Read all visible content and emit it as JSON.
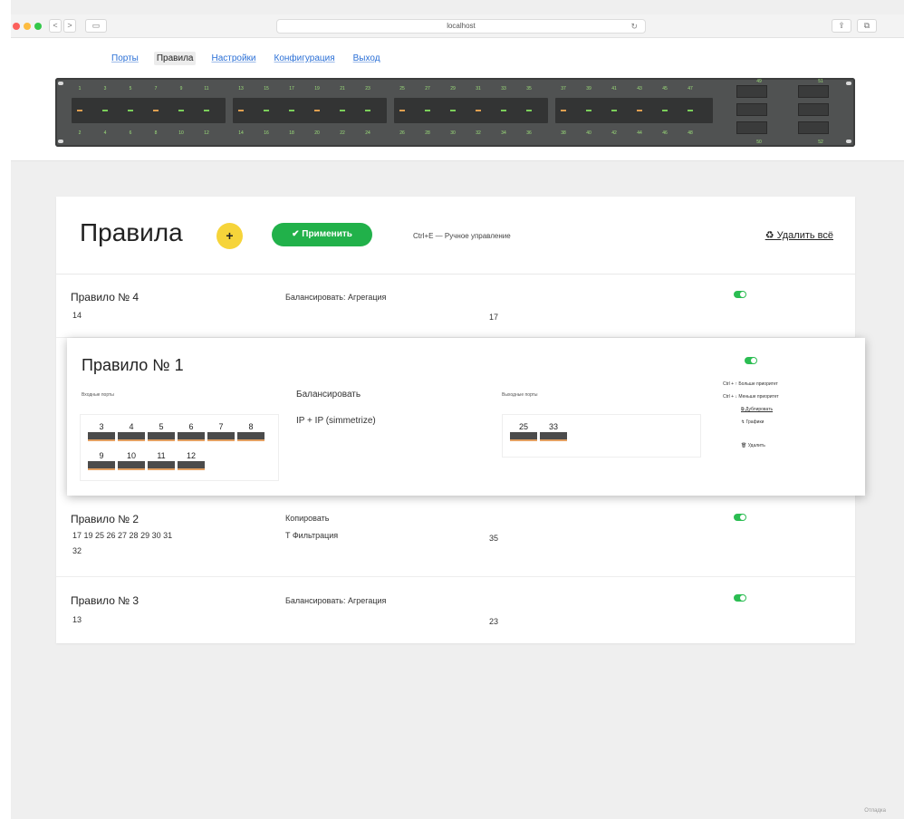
{
  "browser": {
    "url": "localhost",
    "buttons": {
      "back": "<",
      "forward": ">",
      "sidebar": "▭",
      "share": "⇪",
      "tabs": "⧉"
    },
    "reload_icon": "↻"
  },
  "nav": [
    {
      "label": "Порты",
      "active": false
    },
    {
      "label": "Правила",
      "active": true
    },
    {
      "label": "Настройки",
      "active": false
    },
    {
      "label": "Конфигурация",
      "active": false
    },
    {
      "label": "Выход",
      "active": false
    }
  ],
  "switch": {
    "top_ports": [
      "1",
      "3",
      "5",
      "7",
      "9",
      "11",
      "13",
      "15",
      "17",
      "19",
      "21",
      "23",
      "25",
      "27",
      "29",
      "31",
      "33",
      "35",
      "37",
      "39",
      "41",
      "43",
      "45",
      "47"
    ],
    "bottom_ports": [
      "2",
      "4",
      "6",
      "8",
      "10",
      "12",
      "14",
      "16",
      "18",
      "20",
      "22",
      "24",
      "26",
      "28",
      "30",
      "32",
      "34",
      "36",
      "38",
      "40",
      "42",
      "44",
      "46",
      "48"
    ],
    "uplinks_top": [
      "49",
      "51"
    ],
    "uplinks_bottom": [
      "50",
      "52"
    ]
  },
  "rules_page": {
    "title": "Правила",
    "add_label": "+",
    "apply_label": "✔ Применить",
    "hint": "Ctrl+E — Ручное управление",
    "delete_all": "♻ Удалить всё"
  },
  "rules": [
    {
      "name": "Правило № 4",
      "action": "Балансировать: Агрегация",
      "filter": "",
      "in_ports": "14",
      "out_ports": "17",
      "enabled": true
    },
    {
      "name": "Правило № 2",
      "action": "Копировать",
      "filter": "T Фильтрация",
      "in_ports": "17  19  25  26  27  28  29  30  31",
      "in_ports_2": "32",
      "out_ports": "35",
      "enabled": true
    },
    {
      "name": "Правило № 3",
      "action": "Балансировать: Агрегация",
      "filter": "",
      "in_ports": "13",
      "out_ports": "23",
      "enabled": true
    }
  ],
  "expanded_rule": {
    "name": "Правило № 1",
    "in_label": "Входные порты",
    "action": "Балансировать",
    "mode": "IP + IP (simmetrize)",
    "out_label": "Выходные порты",
    "in_ports": [
      "3",
      "4",
      "5",
      "6",
      "7",
      "8",
      "9",
      "10",
      "11",
      "12"
    ],
    "out_ports": [
      "25",
      "33"
    ],
    "enabled": true,
    "options": [
      {
        "label": "Ctrl + ↑ Больше приоритет",
        "underline": false
      },
      {
        "label": "Ctrl + ↓ Меньше приоритет",
        "underline": false
      },
      {
        "label": "⧉ Дублировать",
        "underline": true
      },
      {
        "label": "↯ Графики",
        "underline": false
      },
      {
        "label": "🗑 Удалить",
        "underline": false
      }
    ]
  },
  "footer": "Отладка",
  "colors": {
    "accent": "#21b14a",
    "add": "#f6d43a",
    "link": "#2a6fd6"
  }
}
